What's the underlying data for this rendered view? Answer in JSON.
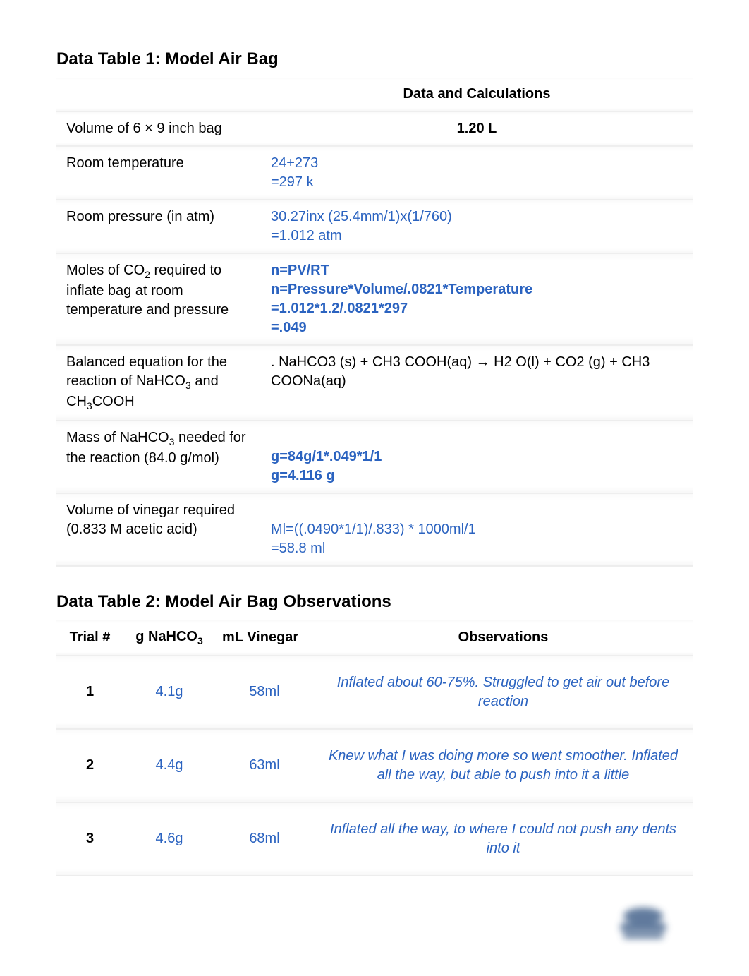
{
  "table1": {
    "title": "Data Table 1: Model Air Bag",
    "header_right": "Data and Calculations",
    "rows": {
      "r1": {
        "label": "Volume of 6 × 9 inch bag",
        "value": "1.20 L"
      },
      "r2": {
        "label": "Room temperature",
        "line1": "24+273",
        "line2": "=297 k"
      },
      "r3": {
        "label": "Room pressure (in atm)",
        "line1": "30.27inx (25.4mm/1)x(1/760)",
        "line2": "=1.012 atm"
      },
      "r4": {
        "label_a": "Moles of CO",
        "label_b": " required to inflate bag at room temperature and pressure",
        "line1": "n=PV/RT",
        "line2": "n=Pressure*Volume/.0821*Temperature",
        "line3": "=1.012*1.2/.0821*297",
        "line4": "=.049"
      },
      "r5": {
        "label_a": "Balanced equation for the reaction of NaHCO",
        "label_b": " and CH",
        "label_c": "COOH",
        "value": ". NaHCO3 (s) + CH3 COOH(aq) → H2 O(l) + CO2 (g) + CH3 COONa(aq)"
      },
      "r6": {
        "label_a": "Mass of NaHCO",
        "label_b": " needed for the reaction (84.0 g/mol)",
        "line1": "g=84g/1*.049*1/1",
        "line2": "g=4.116 g"
      },
      "r7": {
        "label_a": "Volume of vinegar required",
        "label_b": "(0.833 M acetic acid)",
        "line1": "Ml=((.0490*1/1)/.833) * 1000ml/1",
        "line2": "=58.8 ml"
      }
    }
  },
  "table2": {
    "title": "Data Table 2: Model Air Bag Observations",
    "headers": {
      "trial": "Trial #",
      "g_label_a": "g NaHCO",
      "ml": "mL Vinegar",
      "obs": "Observations"
    },
    "rows": [
      {
        "trial": "1",
        "g": "4.1g",
        "ml": "58ml",
        "obs": "Inflated about 60-75%. Struggled to get air out before reaction"
      },
      {
        "trial": "2",
        "g": "4.4g",
        "ml": "63ml",
        "obs": "Knew what I was doing more so went smoother. Inflated all the way, but able to push into it a little"
      },
      {
        "trial": "3",
        "g": "4.6g",
        "ml": "68ml",
        "obs": "Inflated all the way, to where I could not push any dents into it"
      }
    ]
  }
}
